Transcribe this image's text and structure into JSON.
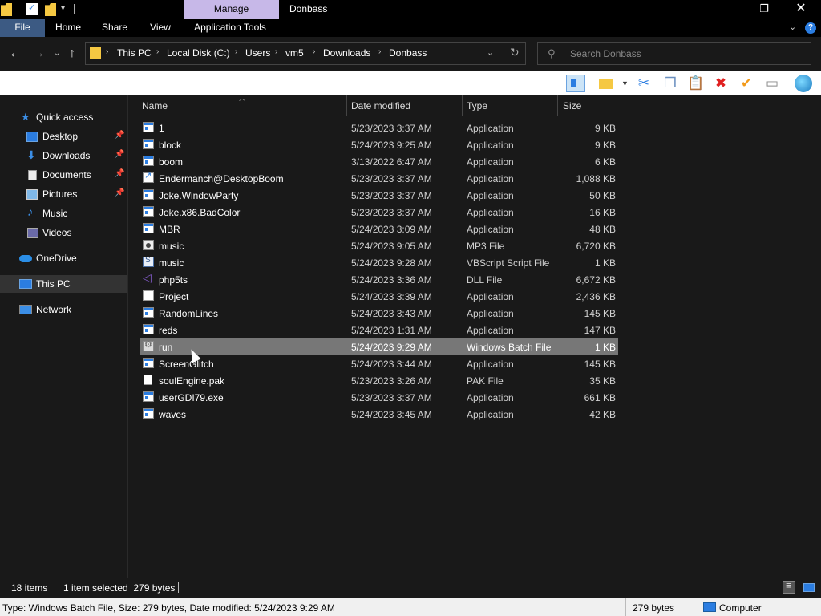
{
  "titlebar": {
    "manage_tab": "Manage",
    "title": "Donbass"
  },
  "ribbon": {
    "tabs": [
      {
        "label": "File"
      },
      {
        "label": "Home"
      },
      {
        "label": "Share"
      },
      {
        "label": "View"
      },
      {
        "label": "Application Tools"
      }
    ]
  },
  "address": {
    "breadcrumbs": [
      "This PC",
      "Local Disk (C:)",
      "Users",
      "vm5",
      "Downloads",
      "Donbass"
    ],
    "search_placeholder": "Search Donbass"
  },
  "nav": {
    "items": [
      {
        "label": "Quick access",
        "icon": "star-icon",
        "pinned": false
      },
      {
        "label": "Desktop",
        "icon": "desktop-icon",
        "pinned": true
      },
      {
        "label": "Downloads",
        "icon": "downloads-icon",
        "pinned": true
      },
      {
        "label": "Documents",
        "icon": "documents-icon",
        "pinned": true
      },
      {
        "label": "Pictures",
        "icon": "pictures-icon",
        "pinned": true
      },
      {
        "label": "Music",
        "icon": "music-icon",
        "pinned": false
      },
      {
        "label": "Videos",
        "icon": "videos-icon",
        "pinned": false
      },
      {
        "label": "OneDrive",
        "icon": "cloud-icon",
        "pinned": false
      },
      {
        "label": "This PC",
        "icon": "computer-icon",
        "pinned": false,
        "selected": true
      },
      {
        "label": "Network",
        "icon": "network-icon",
        "pinned": false
      }
    ]
  },
  "columns": {
    "name": "Name",
    "date": "Date modified",
    "type": "Type",
    "size": "Size"
  },
  "files": [
    {
      "name": "1",
      "date": "5/23/2023 3:37 AM",
      "type": "Application",
      "size": "9 KB",
      "icon": "app"
    },
    {
      "name": "block",
      "date": "5/24/2023 9:25 AM",
      "type": "Application",
      "size": "9 KB",
      "icon": "app"
    },
    {
      "name": "boom",
      "date": "3/13/2022 6:47 AM",
      "type": "Application",
      "size": "6 KB",
      "icon": "app"
    },
    {
      "name": "Endermanch@DesktopBoom",
      "date": "5/23/2023 3:37 AM",
      "type": "Application",
      "size": "1,088 KB",
      "icon": "link"
    },
    {
      "name": "Joke.WindowParty",
      "date": "5/23/2023 3:37 AM",
      "type": "Application",
      "size": "50 KB",
      "icon": "app"
    },
    {
      "name": "Joke.x86.BadColor",
      "date": "5/23/2023 3:37 AM",
      "type": "Application",
      "size": "16 KB",
      "icon": "app"
    },
    {
      "name": "MBR",
      "date": "5/24/2023 3:09 AM",
      "type": "Application",
      "size": "48 KB",
      "icon": "app"
    },
    {
      "name": "music",
      "date": "5/24/2023 9:05 AM",
      "type": "MP3 File",
      "size": "6,720 KB",
      "icon": "mp3"
    },
    {
      "name": "music",
      "date": "5/24/2023 9:28 AM",
      "type": "VBScript Script File",
      "size": "1 KB",
      "icon": "vbs"
    },
    {
      "name": "php5ts",
      "date": "5/24/2023 3:36 AM",
      "type": "DLL File",
      "size": "6,672 KB",
      "icon": "dll"
    },
    {
      "name": "Project",
      "date": "5/24/2023 3:39 AM",
      "type": "Application",
      "size": "2,436 KB",
      "icon": "plain"
    },
    {
      "name": "RandomLines",
      "date": "5/24/2023 3:43 AM",
      "type": "Application",
      "size": "145 KB",
      "icon": "app"
    },
    {
      "name": "reds",
      "date": "5/24/2023 1:31 AM",
      "type": "Application",
      "size": "147 KB",
      "icon": "app"
    },
    {
      "name": "run",
      "date": "5/24/2023 9:29 AM",
      "type": "Windows Batch File",
      "size": "1 KB",
      "icon": "bat",
      "selected": true
    },
    {
      "name": "ScreenGlitch",
      "date": "5/24/2023 3:44 AM",
      "type": "Application",
      "size": "145 KB",
      "icon": "app"
    },
    {
      "name": "soulEngine.pak",
      "date": "5/23/2023 3:26 AM",
      "type": "PAK File",
      "size": "35 KB",
      "icon": "pak"
    },
    {
      "name": "userGDI79.exe",
      "date": "5/23/2023 3:37 AM",
      "type": "Application",
      "size": "661 KB",
      "icon": "app"
    },
    {
      "name": "waves",
      "date": "5/24/2023 3:45 AM",
      "type": "Application",
      "size": "42 KB",
      "icon": "app"
    }
  ],
  "status": {
    "item_count": "18 items",
    "selection": "1 item selected  279 bytes"
  },
  "infobar": {
    "details": "Type: Windows Batch File, Size: 279 bytes, Date modified: 5/24/2023 9:29 AM",
    "size": "279 bytes",
    "location": "Computer"
  },
  "colors": {
    "background": "#191919",
    "selected_row": "#777777",
    "file_tab": "#3c5a83",
    "manage_tab": "#c7b8e8"
  }
}
